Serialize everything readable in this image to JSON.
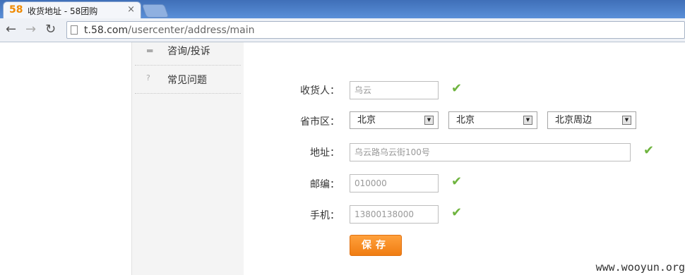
{
  "browser": {
    "favicon_text": "58",
    "tab_title": "收货地址 - 58团购",
    "tab_close": "×",
    "url_host": "t.58.com",
    "url_path": "/usercenter/address/main"
  },
  "sidebar": {
    "items": [
      {
        "label": "咨询/投诉",
        "icon": "chat-icon"
      },
      {
        "label": "常见问题",
        "icon": "question-icon",
        "glyph": "?"
      }
    ]
  },
  "form": {
    "receiver": {
      "label": "收货人：",
      "value": "乌云"
    },
    "region": {
      "label": "省市区：",
      "province": "北京",
      "city": "北京",
      "district": "北京周边"
    },
    "address": {
      "label": "地址：",
      "value": "乌云路乌云街100号"
    },
    "postcode": {
      "label": "邮编：",
      "value": "010000"
    },
    "phone": {
      "label": "手机：",
      "value": "13800138000"
    },
    "save_label": "保存"
  },
  "watermark": "www.wooyun.org",
  "colors": {
    "accent": "#f08a00",
    "check": "#6fb43f"
  }
}
